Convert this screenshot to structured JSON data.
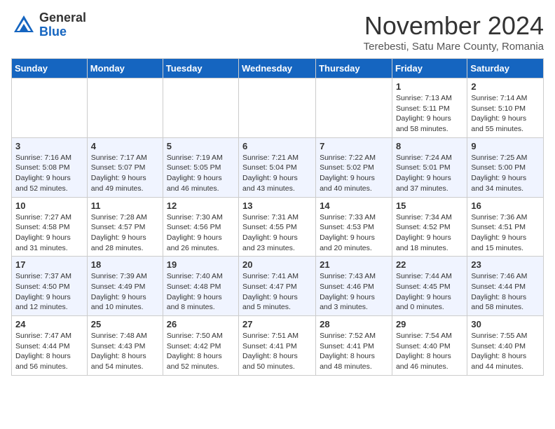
{
  "logo": {
    "general": "General",
    "blue": "Blue"
  },
  "header": {
    "month": "November 2024",
    "location": "Terebesti, Satu Mare County, Romania"
  },
  "weekdays": [
    "Sunday",
    "Monday",
    "Tuesday",
    "Wednesday",
    "Thursday",
    "Friday",
    "Saturday"
  ],
  "weeks": [
    [
      {
        "day": "",
        "info": ""
      },
      {
        "day": "",
        "info": ""
      },
      {
        "day": "",
        "info": ""
      },
      {
        "day": "",
        "info": ""
      },
      {
        "day": "",
        "info": ""
      },
      {
        "day": "1",
        "info": "Sunrise: 7:13 AM\nSunset: 5:11 PM\nDaylight: 9 hours and 58 minutes."
      },
      {
        "day": "2",
        "info": "Sunrise: 7:14 AM\nSunset: 5:10 PM\nDaylight: 9 hours and 55 minutes."
      }
    ],
    [
      {
        "day": "3",
        "info": "Sunrise: 7:16 AM\nSunset: 5:08 PM\nDaylight: 9 hours and 52 minutes."
      },
      {
        "day": "4",
        "info": "Sunrise: 7:17 AM\nSunset: 5:07 PM\nDaylight: 9 hours and 49 minutes."
      },
      {
        "day": "5",
        "info": "Sunrise: 7:19 AM\nSunset: 5:05 PM\nDaylight: 9 hours and 46 minutes."
      },
      {
        "day": "6",
        "info": "Sunrise: 7:21 AM\nSunset: 5:04 PM\nDaylight: 9 hours and 43 minutes."
      },
      {
        "day": "7",
        "info": "Sunrise: 7:22 AM\nSunset: 5:02 PM\nDaylight: 9 hours and 40 minutes."
      },
      {
        "day": "8",
        "info": "Sunrise: 7:24 AM\nSunset: 5:01 PM\nDaylight: 9 hours and 37 minutes."
      },
      {
        "day": "9",
        "info": "Sunrise: 7:25 AM\nSunset: 5:00 PM\nDaylight: 9 hours and 34 minutes."
      }
    ],
    [
      {
        "day": "10",
        "info": "Sunrise: 7:27 AM\nSunset: 4:58 PM\nDaylight: 9 hours and 31 minutes."
      },
      {
        "day": "11",
        "info": "Sunrise: 7:28 AM\nSunset: 4:57 PM\nDaylight: 9 hours and 28 minutes."
      },
      {
        "day": "12",
        "info": "Sunrise: 7:30 AM\nSunset: 4:56 PM\nDaylight: 9 hours and 26 minutes."
      },
      {
        "day": "13",
        "info": "Sunrise: 7:31 AM\nSunset: 4:55 PM\nDaylight: 9 hours and 23 minutes."
      },
      {
        "day": "14",
        "info": "Sunrise: 7:33 AM\nSunset: 4:53 PM\nDaylight: 9 hours and 20 minutes."
      },
      {
        "day": "15",
        "info": "Sunrise: 7:34 AM\nSunset: 4:52 PM\nDaylight: 9 hours and 18 minutes."
      },
      {
        "day": "16",
        "info": "Sunrise: 7:36 AM\nSunset: 4:51 PM\nDaylight: 9 hours and 15 minutes."
      }
    ],
    [
      {
        "day": "17",
        "info": "Sunrise: 7:37 AM\nSunset: 4:50 PM\nDaylight: 9 hours and 12 minutes."
      },
      {
        "day": "18",
        "info": "Sunrise: 7:39 AM\nSunset: 4:49 PM\nDaylight: 9 hours and 10 minutes."
      },
      {
        "day": "19",
        "info": "Sunrise: 7:40 AM\nSunset: 4:48 PM\nDaylight: 9 hours and 8 minutes."
      },
      {
        "day": "20",
        "info": "Sunrise: 7:41 AM\nSunset: 4:47 PM\nDaylight: 9 hours and 5 minutes."
      },
      {
        "day": "21",
        "info": "Sunrise: 7:43 AM\nSunset: 4:46 PM\nDaylight: 9 hours and 3 minutes."
      },
      {
        "day": "22",
        "info": "Sunrise: 7:44 AM\nSunset: 4:45 PM\nDaylight: 9 hours and 0 minutes."
      },
      {
        "day": "23",
        "info": "Sunrise: 7:46 AM\nSunset: 4:44 PM\nDaylight: 8 hours and 58 minutes."
      }
    ],
    [
      {
        "day": "24",
        "info": "Sunrise: 7:47 AM\nSunset: 4:44 PM\nDaylight: 8 hours and 56 minutes."
      },
      {
        "day": "25",
        "info": "Sunrise: 7:48 AM\nSunset: 4:43 PM\nDaylight: 8 hours and 54 minutes."
      },
      {
        "day": "26",
        "info": "Sunrise: 7:50 AM\nSunset: 4:42 PM\nDaylight: 8 hours and 52 minutes."
      },
      {
        "day": "27",
        "info": "Sunrise: 7:51 AM\nSunset: 4:41 PM\nDaylight: 8 hours and 50 minutes."
      },
      {
        "day": "28",
        "info": "Sunrise: 7:52 AM\nSunset: 4:41 PM\nDaylight: 8 hours and 48 minutes."
      },
      {
        "day": "29",
        "info": "Sunrise: 7:54 AM\nSunset: 4:40 PM\nDaylight: 8 hours and 46 minutes."
      },
      {
        "day": "30",
        "info": "Sunrise: 7:55 AM\nSunset: 4:40 PM\nDaylight: 8 hours and 44 minutes."
      }
    ]
  ]
}
